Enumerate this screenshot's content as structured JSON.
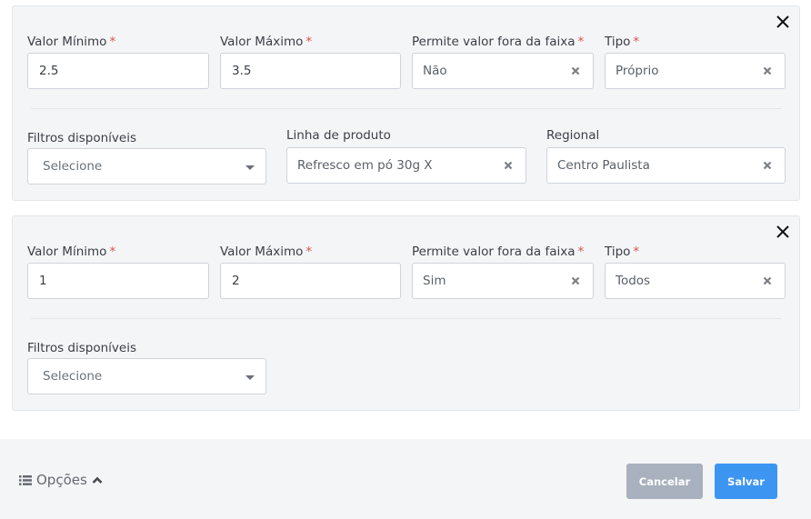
{
  "rules": [
    {
      "min_label": "Valor Mínimo",
      "max_label": "Valor Máximo",
      "out_of_range_label": "Permite valor fora da faixa",
      "type_label": "Tipo",
      "required_mark": "*",
      "min_value": "2.5",
      "max_value": "3.5",
      "out_of_range_value": "Não",
      "type_value": "Próprio",
      "filters_label": "Filtros disponíveis",
      "filters_placeholder": "Selecione",
      "product_line_label": "Linha de produto",
      "product_line_value": "Refresco em pó 30g X",
      "regional_label": "Regional",
      "regional_value": "Centro Paulista"
    },
    {
      "min_label": "Valor Mínimo",
      "max_label": "Valor Máximo",
      "out_of_range_label": "Permite valor fora da faixa",
      "type_label": "Tipo",
      "required_mark": "*",
      "min_value": "1",
      "max_value": "2",
      "out_of_range_value": "Sim",
      "type_value": "Todos",
      "filters_label": "Filtros disponíveis",
      "filters_placeholder": "Selecione"
    }
  ],
  "footer": {
    "options_label": "Opções",
    "cancel_label": "Cancelar",
    "save_label": "Salvar"
  },
  "icons": {
    "close": "close-icon",
    "clear": "clear-x-icon",
    "dropdown": "caret-down-icon",
    "list": "list-icon",
    "chevron": "chevron-up-icon"
  },
  "colors": {
    "required": "#d9534f",
    "primary": "#3d95f2",
    "secondary": "#a8b1bd",
    "card_bg": "#f4f5f7"
  }
}
